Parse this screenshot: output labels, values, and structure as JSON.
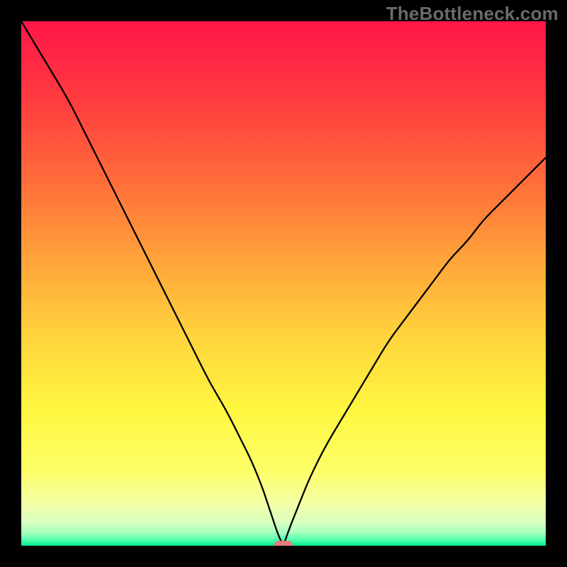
{
  "watermark": "TheBottleneck.com",
  "chart_data": {
    "type": "line",
    "title": "",
    "xlabel": "",
    "ylabel": "",
    "xlim": [
      0,
      100
    ],
    "ylim": [
      0,
      100
    ],
    "grid": false,
    "series": [
      {
        "name": "bottleneck-curve",
        "x": [
          0,
          3,
          6,
          9,
          12,
          15,
          18,
          21,
          24,
          27,
          30,
          33,
          36,
          39,
          42,
          44,
          46,
          47,
          48,
          49,
          50,
          51,
          53,
          55,
          58,
          61,
          64,
          67,
          70,
          73,
          76,
          79,
          82,
          85,
          88,
          91,
          94,
          97,
          100
        ],
        "values": [
          100,
          95,
          90,
          85,
          79,
          73,
          67,
          61,
          55,
          49,
          43,
          37,
          31,
          26,
          20,
          16,
          11,
          8,
          5,
          2,
          0,
          3,
          8,
          13,
          19,
          24,
          29,
          34,
          39,
          43,
          47,
          51,
          55,
          58,
          62,
          65,
          68,
          71,
          74
        ]
      }
    ],
    "optimal_marker": {
      "x": 50,
      "y": 0,
      "color": "#e77b78"
    },
    "background": {
      "type": "vertical-gradient",
      "stops": [
        {
          "pos": 0.0,
          "color": "#ff1648"
        },
        {
          "pos": 0.15,
          "color": "#ff3b3f"
        },
        {
          "pos": 0.3,
          "color": "#ff6b3a"
        },
        {
          "pos": 0.45,
          "color": "#ffa23a"
        },
        {
          "pos": 0.6,
          "color": "#ffd33c"
        },
        {
          "pos": 0.74,
          "color": "#fff640"
        },
        {
          "pos": 0.86,
          "color": "#fdff6a"
        },
        {
          "pos": 0.92,
          "color": "#f3ffa6"
        },
        {
          "pos": 0.955,
          "color": "#d9ffbf"
        },
        {
          "pos": 0.975,
          "color": "#a6ffbe"
        },
        {
          "pos": 0.99,
          "color": "#4affab"
        },
        {
          "pos": 1.0,
          "color": "#00e98f"
        }
      ]
    }
  }
}
